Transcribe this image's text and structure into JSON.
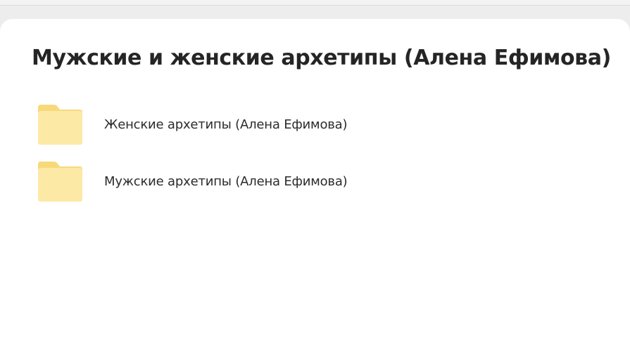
{
  "page": {
    "title": "Мужские и женские архетипы (Алена Ефимова)"
  },
  "folders": [
    {
      "name": "Женские архетипы (Алена Ефимова)",
      "icon": "folder-icon"
    },
    {
      "name": "Мужские архетипы (Алена Ефимова)",
      "icon": "folder-icon"
    }
  ],
  "colors": {
    "folder_back": "#fbe08f",
    "folder_front": "#fdeaa8",
    "page_background": "#ffffff",
    "chrome_background": "#ededee"
  }
}
